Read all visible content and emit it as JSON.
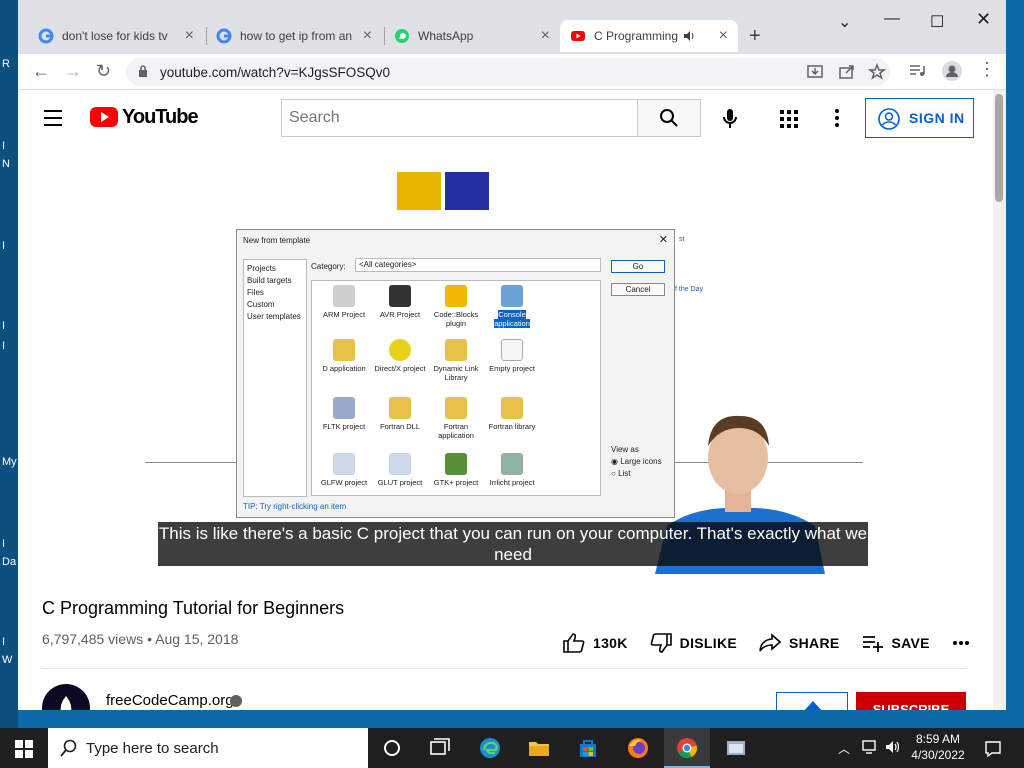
{
  "desktop": {
    "labels": [
      "R",
      "I",
      "N",
      "I",
      "I",
      "I",
      "My",
      "I",
      "Da",
      "I",
      "W"
    ]
  },
  "browser": {
    "tabs": [
      {
        "title": "don't lose for kids tv",
        "favicon": "google-icon",
        "active": false
      },
      {
        "title": "how to get ip from an",
        "favicon": "google-icon",
        "active": false
      },
      {
        "title": "WhatsApp",
        "favicon": "whatsapp-icon",
        "active": false
      },
      {
        "title": "C Programming",
        "favicon": "youtube-icon",
        "active": true,
        "audio": true
      }
    ],
    "url": "youtube.com/watch?v=KJgsSFOSQv0"
  },
  "youtube": {
    "logo_text": "YouTube",
    "search_placeholder": "Search",
    "sign_in": "SIGN IN",
    "video": {
      "caption": "This is like there's a basic C project that you can run on your computer. That's exactly what we need",
      "dialog": {
        "title": "New from template",
        "left_list": [
          "Projects",
          "Build targets",
          "Files",
          "Custom",
          "User templates"
        ],
        "category_label": "Category:",
        "category_value": "<All categories>",
        "templates": [
          "ARM Project",
          "AVR Project",
          "Code::Blocks plugin",
          "Console application",
          "D application",
          "Direct/X project",
          "Dynamic Link Library",
          "Empty project",
          "FLTK project",
          "Fortran DLL",
          "Fortran application",
          "Fortran library",
          "GLFW project",
          "GLUT project",
          "GTK+ project",
          "Irrlicht project"
        ],
        "go": "Go",
        "cancel": "Cancel",
        "view_as": "View as",
        "large_icons": "Large icons",
        "list": "List",
        "tip": "TIP: Try right-clicking an item"
      }
    },
    "title": "C Programming Tutorial for Beginners",
    "views": "6,797,485 views",
    "date": "Aug 15, 2018",
    "actions": {
      "like": "130K",
      "dislike": "DISLIKE",
      "share": "SHARE",
      "save": "SAVE"
    },
    "channel": {
      "name": "freeCodeCamp.org",
      "subscribe": "SUBSCRIBE"
    }
  },
  "taskbar": {
    "search_placeholder": "Type here to search",
    "time": "8:59 AM",
    "date": "4/30/2022"
  },
  "colors": {
    "accent": "#065fd4",
    "youtube_red": "#ff0000",
    "subscribe": "#cc0000"
  }
}
